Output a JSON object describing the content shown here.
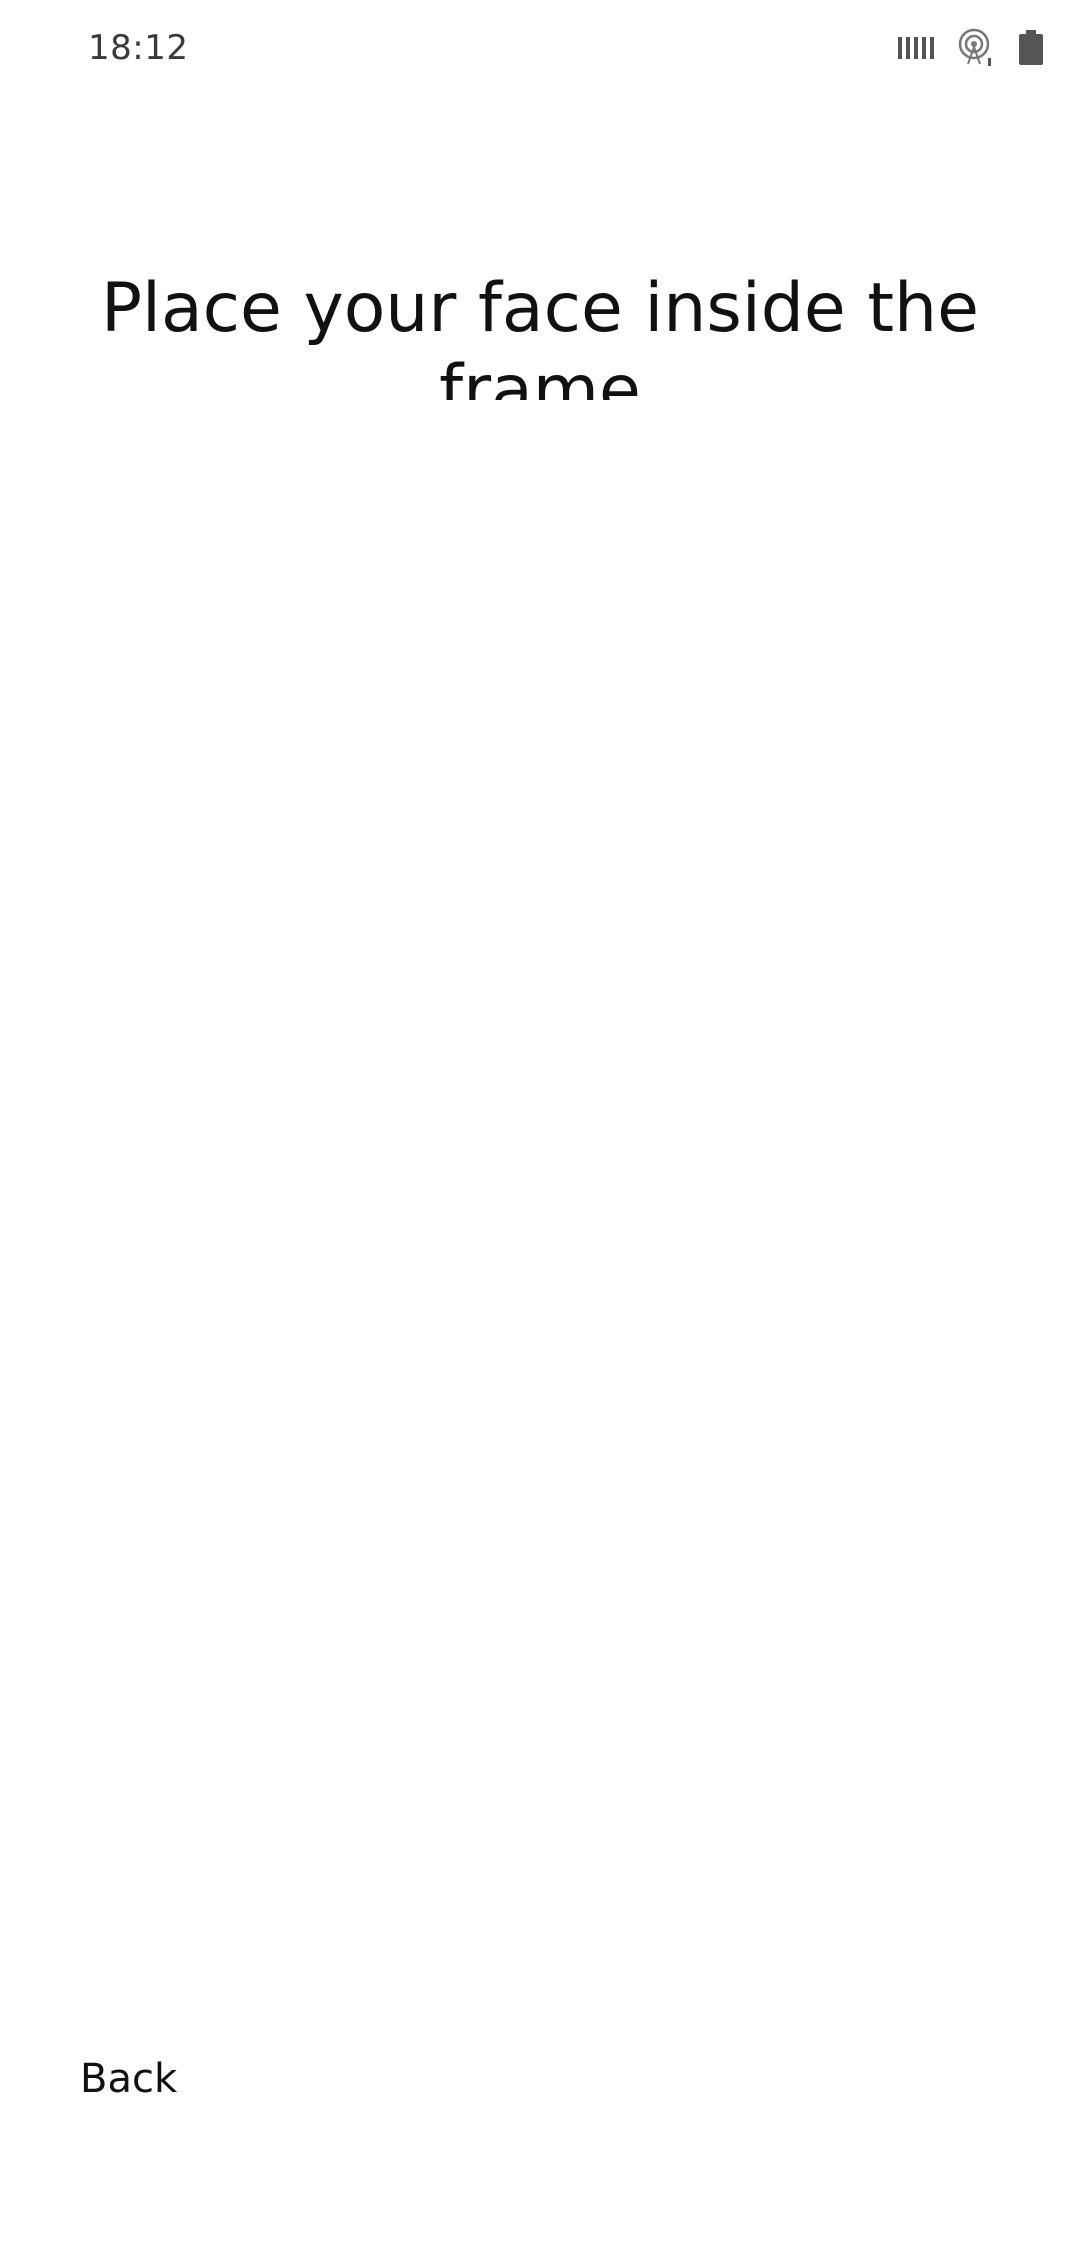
{
  "status_bar": {
    "time": "18:12",
    "icons": [
      "signal-bars-icon",
      "hotspot-icon",
      "battery-icon"
    ]
  },
  "main": {
    "headline": "Place your face inside the frame"
  },
  "footer": {
    "back_label": "Back"
  }
}
